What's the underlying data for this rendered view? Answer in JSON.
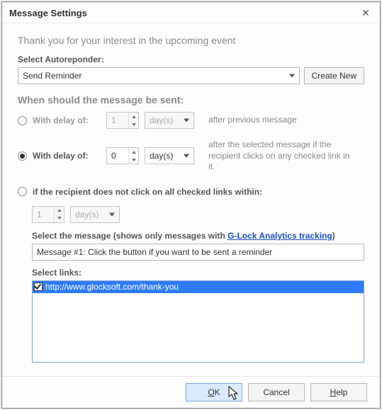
{
  "dialog": {
    "title": "Message Settings",
    "intro": "Thank you for your interest in the upcoming event"
  },
  "autoresponder": {
    "label": "Select Autoreponder:",
    "selected": "Send Reminder",
    "create_new": "Create New"
  },
  "schedule": {
    "heading": "When should the message be sent:",
    "option1": {
      "label": "With delay of:",
      "value": "1",
      "unit": "day(s)",
      "hint": "after previous message",
      "checked": false
    },
    "option2": {
      "label": "With delay of:",
      "value": "0",
      "unit": "day(s)",
      "hint": "after the selected message if the recipient clicks on any checked link in it.",
      "checked": true
    },
    "option3": {
      "label": "if the recipient does not click on all checked links within:",
      "value": "1",
      "unit": "day(s)",
      "checked": false
    }
  },
  "tracking": {
    "select_msg_prefix": "Select the message (shows only messages with ",
    "tracking_link_text": "G-Lock Analytics tracking",
    "select_msg_suffix": ")",
    "selected_message": "Message #1: Click the button if you want to be sent a reminder",
    "select_links_label": "Select links:",
    "links": [
      {
        "url": "http://www.glocksoft.com/thank-you",
        "checked": true
      }
    ]
  },
  "buttons": {
    "ok": "OK",
    "cancel": "Cancel",
    "help": "Help"
  }
}
